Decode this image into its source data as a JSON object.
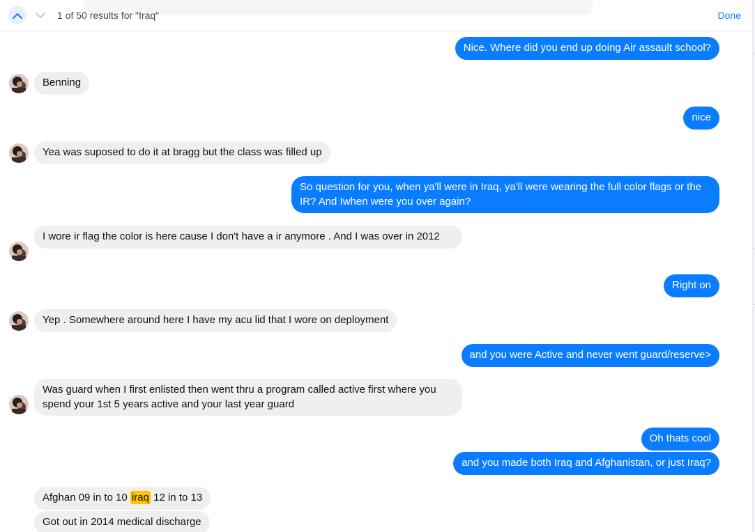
{
  "search": {
    "result_text": "1 of 50 results for \"Iraq\"",
    "done_label": "Done",
    "up_icon": "chevron-up-icon",
    "down_icon": "chevron-down-icon",
    "accent_color": "#0a7cff",
    "highlight_color": "#ffc400"
  },
  "messages": [
    {
      "dir": "out",
      "text": "Nice. Where did you end up doing Air assault school?"
    },
    {
      "dir": "in",
      "text": "Benning"
    },
    {
      "dir": "out",
      "text": "nice"
    },
    {
      "dir": "in",
      "text": "Yea was suposed to do it at bragg but the class was filled up"
    },
    {
      "dir": "out",
      "text": "So question for you, when ya'll were in Iraq, ya'll were wearing the full color flags or the IR?  And Iwhen were you over again?"
    },
    {
      "dir": "in",
      "text": "I wore ir flag the color is here cause I don't have a ir anymore . And I was over in 2012"
    },
    {
      "dir": "out",
      "text": "Right on"
    },
    {
      "dir": "in",
      "text": "Yep . Somewhere around here I have my acu lid that I wore on deployment"
    },
    {
      "dir": "out",
      "text": "and you were Active and never went guard/reserve>"
    },
    {
      "dir": "in",
      "text": "Was guard when I first enlisted then went thru a program called active first where you spend your 1st 5 years active and your last year guard"
    },
    {
      "dir": "out",
      "text": "Oh thats cool"
    },
    {
      "dir": "out",
      "text": "and you made both Iraq and Afghanistan, or just Iraq?"
    },
    {
      "dir": "in",
      "text_before": "Afghan 09 in to 10 ",
      "text_match": "iraq",
      "text_after": " 12 in to 13"
    },
    {
      "dir": "in",
      "text": "Got out in 2014 medical discharge"
    }
  ]
}
